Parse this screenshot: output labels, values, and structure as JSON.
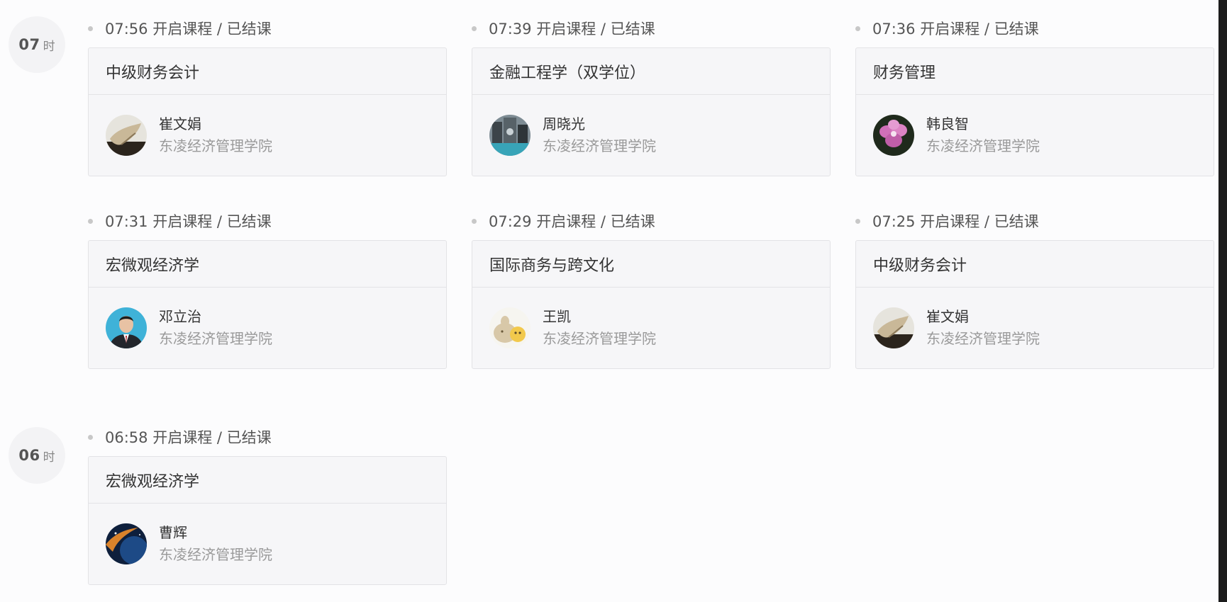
{
  "hours": [
    {
      "number": "07",
      "unit": "时"
    },
    {
      "number": "06",
      "unit": "时"
    }
  ],
  "sessions": [
    {
      "time": "07:56 开启课程 / 已结课",
      "course": "中级财务会计",
      "teacher": "崔文娟",
      "school": "东凌经济管理学院",
      "avatar": "bird-avatar"
    },
    {
      "time": "07:39 开启课程 / 已结课",
      "course": "金融工程学（双学位）",
      "teacher": "周晓光",
      "school": "东凌经济管理学院",
      "avatar": "city-avatar"
    },
    {
      "time": "07:36 开启课程 / 已结课",
      "course": "财务管理",
      "teacher": "韩良智",
      "school": "东凌经济管理学院",
      "avatar": "flower-avatar"
    },
    {
      "time": "07:31 开启课程 / 已结课",
      "course": "宏微观经济学",
      "teacher": "邓立治",
      "school": "东凌经济管理学院",
      "avatar": "person-avatar"
    },
    {
      "time": "07:29 开启课程 / 已结课",
      "course": "国际商务与跨文化",
      "teacher": "王凯",
      "school": "东凌经济管理学院",
      "avatar": "cartoon-avatar"
    },
    {
      "time": "07:25 开启课程 / 已结课",
      "course": "中级财务会计",
      "teacher": "崔文娟",
      "school": "东凌经济管理学院",
      "avatar": "bird-avatar"
    },
    {
      "time": "06:58 开启课程 / 已结课",
      "course": "宏微观经济学",
      "teacher": "曹辉",
      "school": "东凌经济管理学院",
      "avatar": "space-avatar"
    }
  ]
}
